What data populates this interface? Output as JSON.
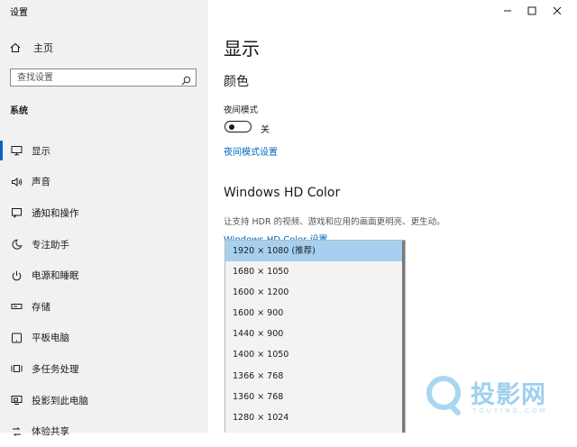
{
  "app": {
    "title": "设置"
  },
  "sidebar": {
    "home_label": "主页",
    "search_placeholder": "查找设置",
    "section_label": "系统",
    "items": [
      {
        "label": "显示",
        "icon": "monitor-icon",
        "active": true
      },
      {
        "label": "声音",
        "icon": "speaker-icon"
      },
      {
        "label": "通知和操作",
        "icon": "notification-icon"
      },
      {
        "label": "专注助手",
        "icon": "moon-icon"
      },
      {
        "label": "电源和睡眠",
        "icon": "power-icon"
      },
      {
        "label": "存储",
        "icon": "storage-icon"
      },
      {
        "label": "平板电脑",
        "icon": "tablet-icon"
      },
      {
        "label": "多任务处理",
        "icon": "multitask-icon"
      },
      {
        "label": "投影到此电脑",
        "icon": "project-icon"
      },
      {
        "label": "体验共享",
        "icon": "share-icon"
      }
    ]
  },
  "main": {
    "title": "显示",
    "color_section": "颜色",
    "night_light_label": "夜间模式",
    "night_light_state": "关",
    "night_light_link": "夜间模式设置",
    "hd_color_title": "Windows HD Color",
    "hd_color_desc": "让支持 HDR 的视频、游戏和应用的画面更明亮、更生动。",
    "hd_color_link": "Windows HD Color 设置"
  },
  "resolution_dropdown": {
    "selected": "1920 × 1080 (推荐)",
    "options": [
      "1920 × 1080 (推荐)",
      "1680 × 1050",
      "1600 × 1200",
      "1600 × 900",
      "1440 × 900",
      "1400 × 1050",
      "1366 × 768",
      "1360 × 768",
      "1280 × 1024"
    ]
  },
  "watermark": {
    "text": "投影网",
    "sub": "TOUYING.COM"
  },
  "colors": {
    "accent": "#0067c0",
    "selected": "#a7d0f0",
    "sidebar_bg": "#f1f1f1"
  }
}
